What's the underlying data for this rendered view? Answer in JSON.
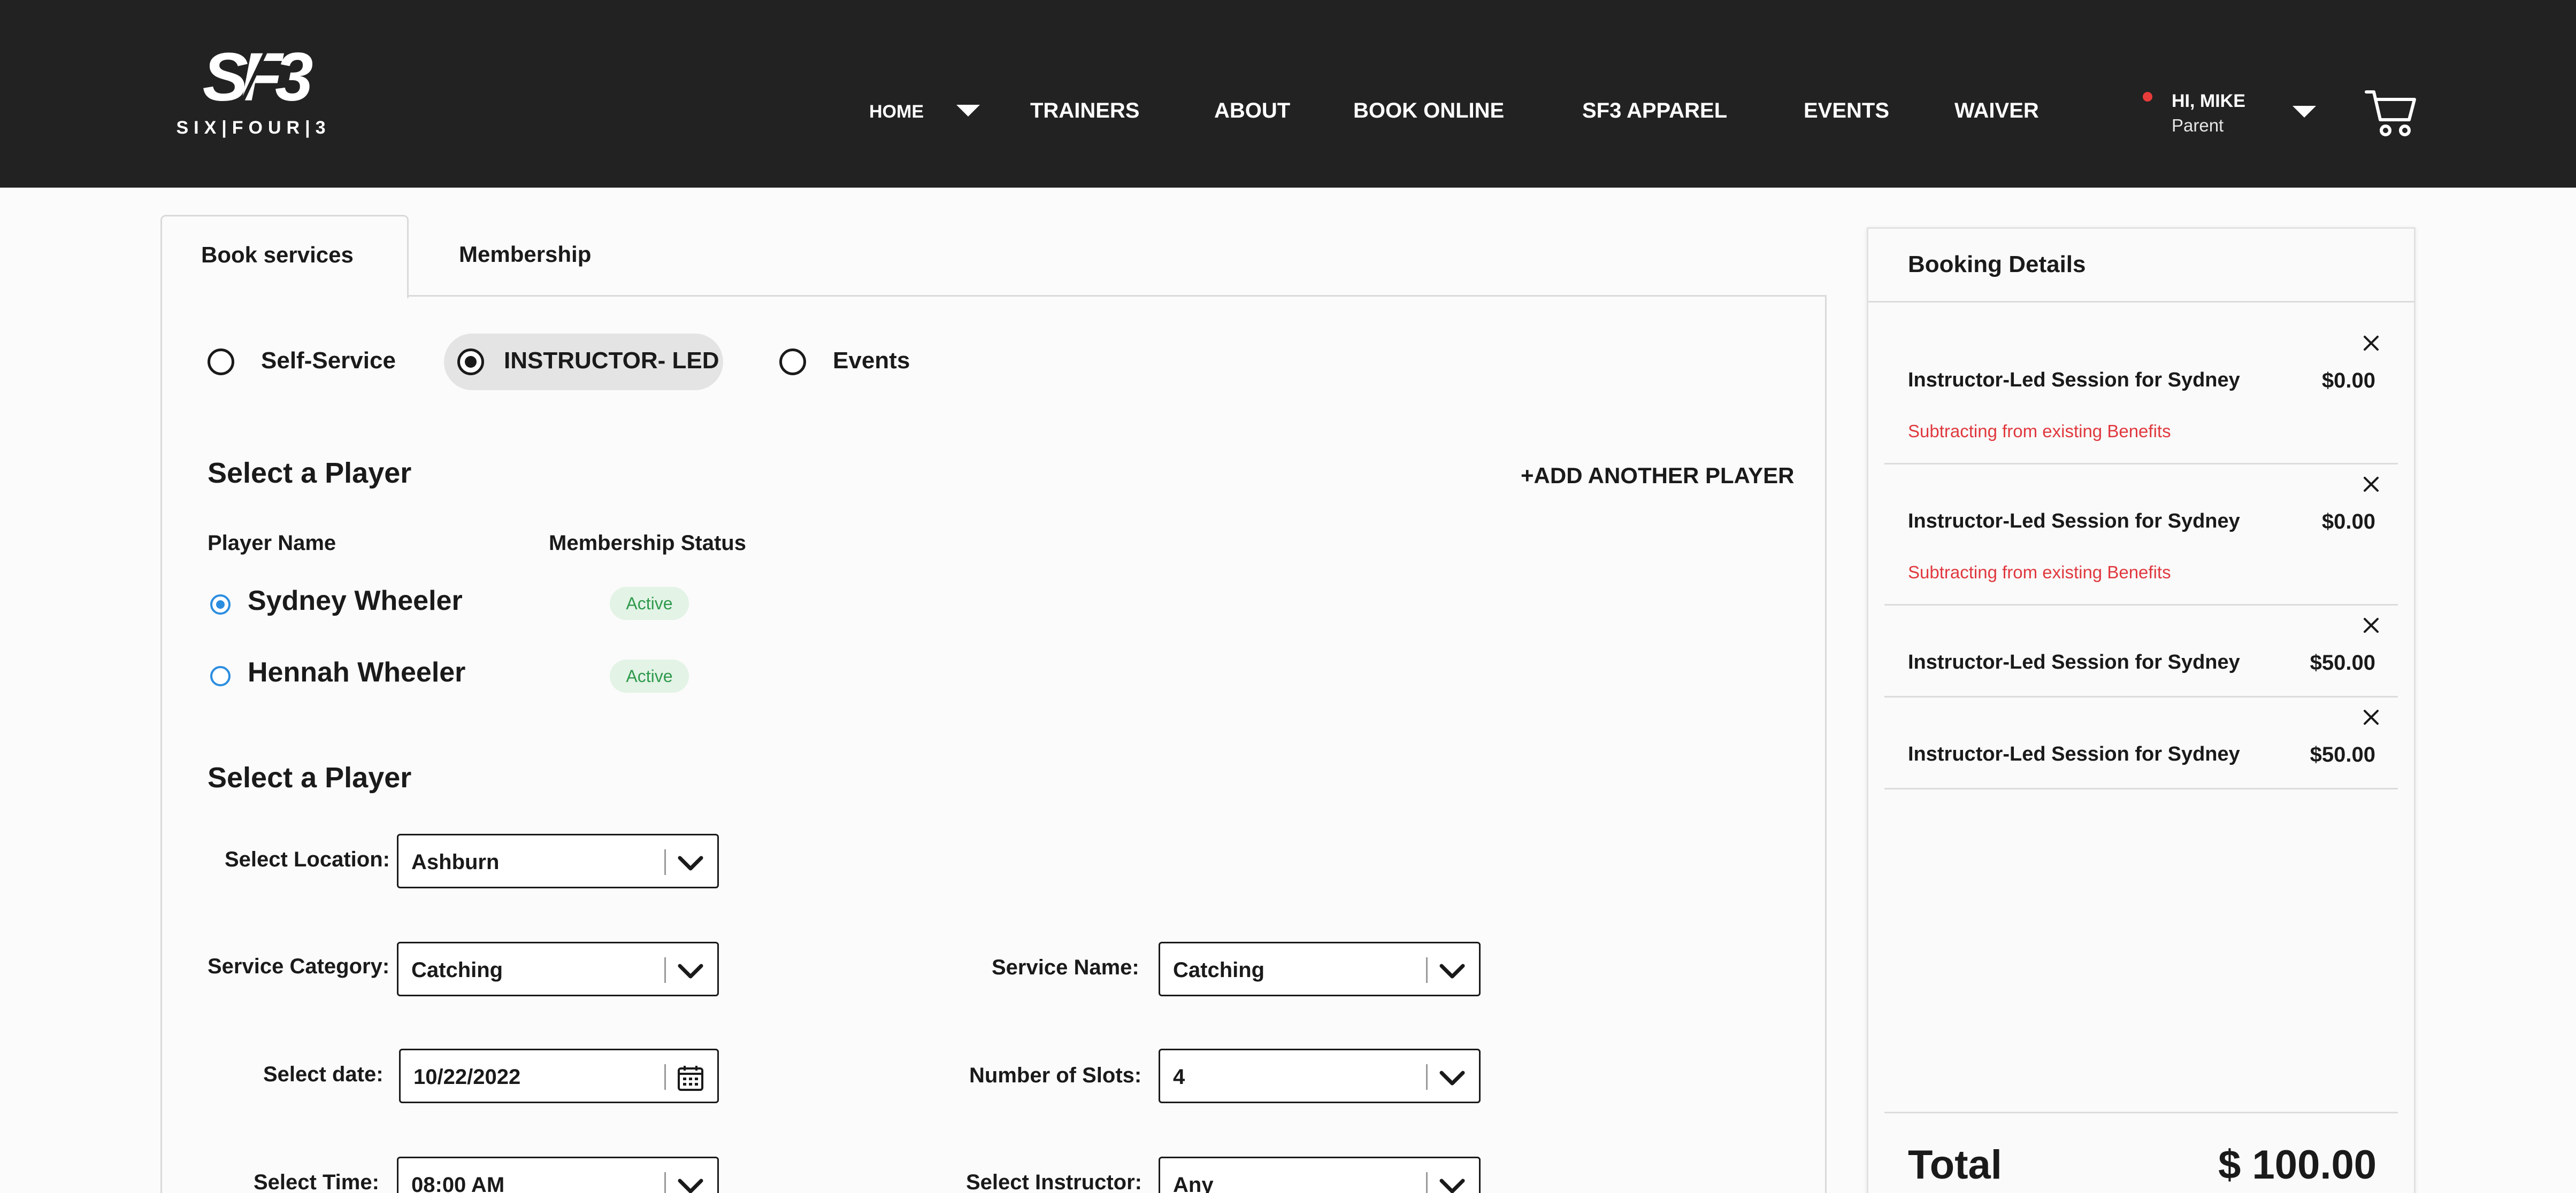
{
  "header": {
    "logo": {
      "mark": "SF3",
      "text": "SIX|FOUR|3"
    },
    "nav": [
      {
        "label": "HOME"
      },
      {
        "label": "TRAINERS"
      },
      {
        "label": "ABOUT"
      },
      {
        "label": "BOOK ONLINE"
      },
      {
        "label": "SF3 APPAREL"
      },
      {
        "label": "EVENTS"
      },
      {
        "label": "WAIVER"
      }
    ],
    "user": {
      "greeting": "HI, MIKE",
      "role": "Parent",
      "status_color": "#e83b3b"
    },
    "cart_icon": "cart-icon"
  },
  "tabs": [
    {
      "label": "Book services",
      "active": true
    },
    {
      "label": "Membership",
      "active": false
    }
  ],
  "service_types": [
    {
      "label": "Self-Service",
      "selected": false
    },
    {
      "label": "INSTRUCTOR- LED",
      "selected": true
    },
    {
      "label": "Events",
      "selected": false
    }
  ],
  "player_section": {
    "title": "Select a Player",
    "add_player": "+ADD ANOTHER PLAYER",
    "col_name": "Player Name",
    "col_status": "Membership Status",
    "players": [
      {
        "name": "Sydney Wheeler",
        "status": "Active",
        "selected": true
      },
      {
        "name": "Hennah Wheeler",
        "status": "Active",
        "selected": false
      }
    ]
  },
  "details_section": {
    "title": "Select a Player",
    "fields": {
      "location": {
        "label": "Select Location:",
        "value": "Ashburn"
      },
      "category": {
        "label": "Service Category:",
        "value": "Catching"
      },
      "service": {
        "label": "Service Name:",
        "value": "Catching"
      },
      "date": {
        "label": "Select date:",
        "value": "10/22/2022"
      },
      "slots": {
        "label": "Number of Slots:",
        "value": "4"
      },
      "time": {
        "label": "Select Time:",
        "value": "08:00 AM"
      },
      "instructor": {
        "label": "Select Instructor:",
        "value": "Any"
      }
    }
  },
  "booking": {
    "title": "Booking Details",
    "items": [
      {
        "name": "Instructor-Led Session for Sydney",
        "price": "$0.00",
        "note": "Subtracting from existing Benefits"
      },
      {
        "name": "Instructor-Led Session for Sydney",
        "price": "$0.00",
        "note": "Subtracting from existing Benefits"
      },
      {
        "name": "Instructor-Led Session for Sydney",
        "price": "$50.00",
        "note": ""
      },
      {
        "name": "Instructor-Led Session for Sydney",
        "price": "$50.00",
        "note": ""
      }
    ],
    "total_label": "Total",
    "total_value": "$ 100.00"
  },
  "colors": {
    "header_bg": "#222222",
    "accent_blue": "#2b8de0",
    "note_red": "#e0383e",
    "badge_green": "#2f9a4c"
  }
}
